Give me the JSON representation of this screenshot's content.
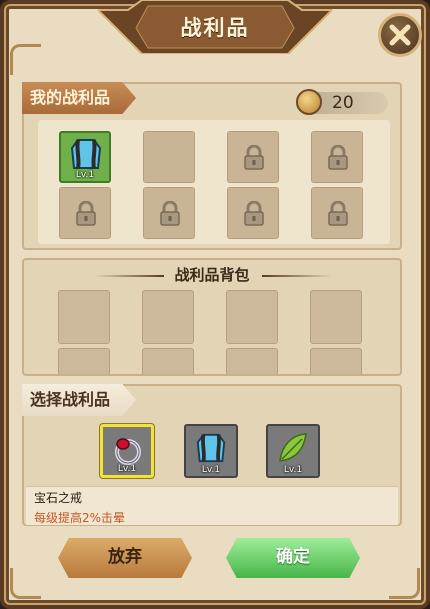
{
  "title": "战利品",
  "close_icon": "close-x-icon",
  "my_trophies": {
    "label": "我的战利品",
    "currency_value": "20",
    "currency_icon": "medal-coin-icon",
    "slots": [
      {
        "state": "equipped",
        "icon": "armor-icon",
        "level": "Lv.1"
      },
      {
        "state": "empty"
      },
      {
        "state": "locked",
        "icon": "lock-icon"
      },
      {
        "state": "locked",
        "icon": "lock-icon"
      },
      {
        "state": "locked",
        "icon": "lock-icon"
      },
      {
        "state": "locked",
        "icon": "lock-icon"
      },
      {
        "state": "locked",
        "icon": "lock-icon"
      },
      {
        "state": "locked",
        "icon": "lock-icon"
      }
    ]
  },
  "bag": {
    "title": "战利品背包"
  },
  "select": {
    "label": "选择战利品",
    "choices": [
      {
        "icon": "gem-ring-icon",
        "level": "Lv.1",
        "selected": true
      },
      {
        "icon": "armor-icon",
        "level": "Lv.1",
        "selected": false
      },
      {
        "icon": "leaf-icon",
        "level": "Lv.1",
        "selected": false
      }
    ],
    "item_name": "宝石之戒",
    "item_effect": "每级提高2%击晕"
  },
  "buttons": {
    "abandon": "放弃",
    "confirm": "确定"
  },
  "colors": {
    "selected_border": "#f2e23a",
    "effect_text": "#c25a28",
    "confirm_green": "#47b548",
    "equipped_green": "#6fb04a"
  }
}
